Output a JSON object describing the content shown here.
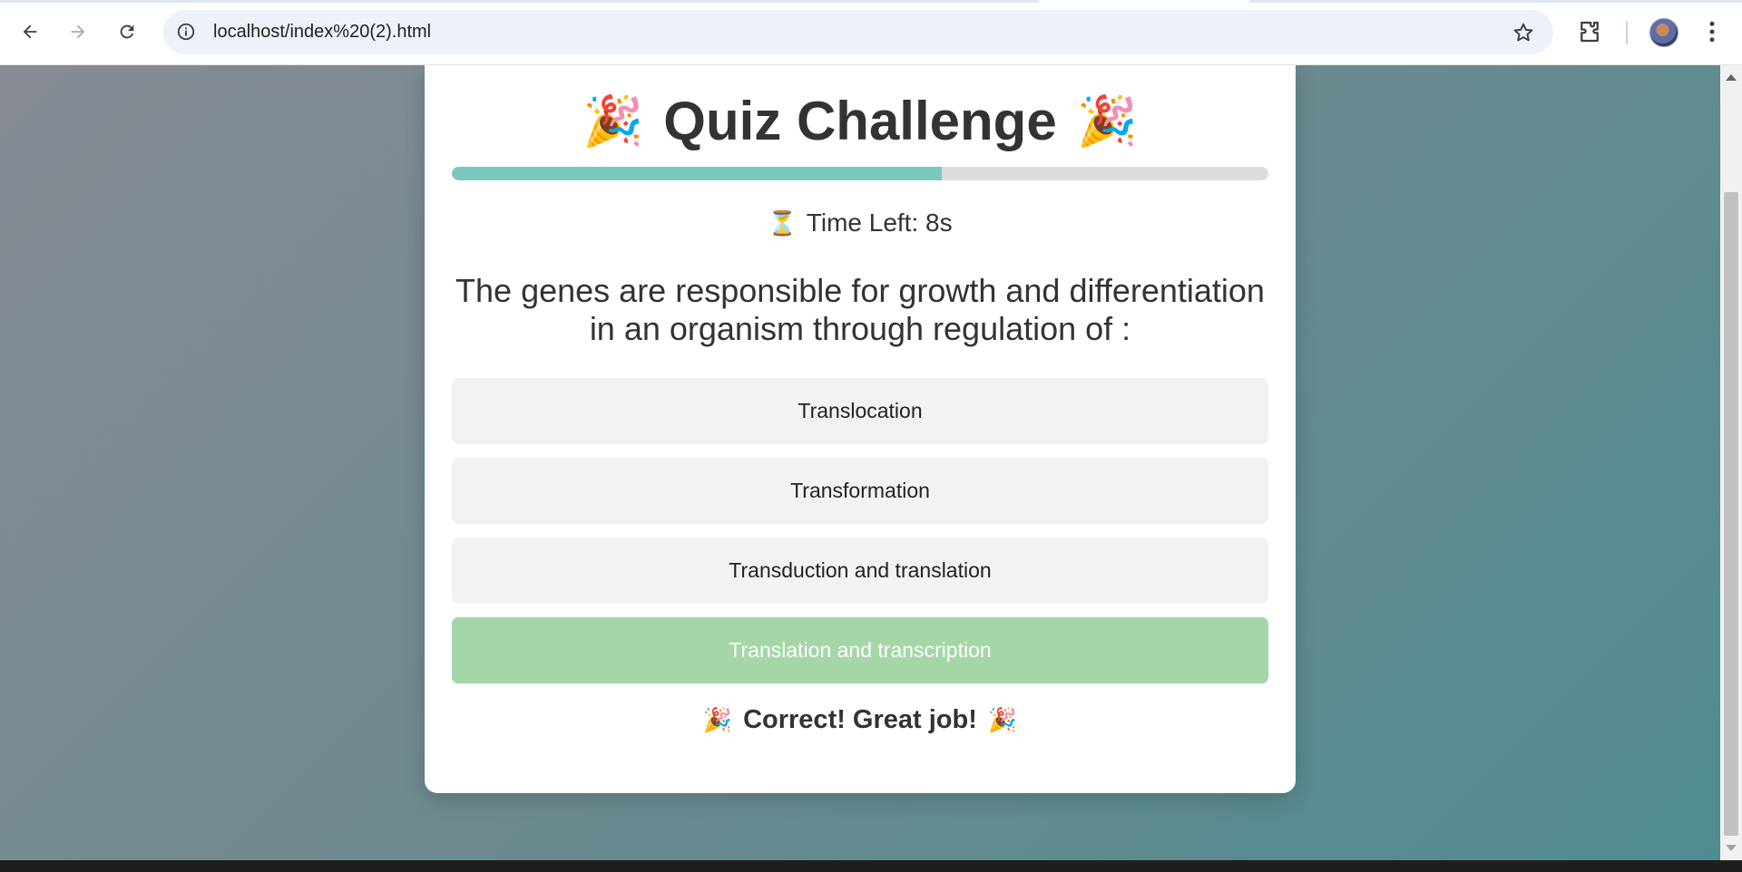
{
  "browser": {
    "url": "localhost/index%20(2).html",
    "icons": {
      "back": "back-arrow-icon",
      "forward": "forward-arrow-icon",
      "reload": "reload-icon",
      "site_info": "info-icon",
      "bookmark": "star-icon",
      "extensions": "puzzle-icon",
      "profile": "avatar",
      "menu": "kebab-menu-icon"
    }
  },
  "quiz": {
    "title": "Quiz Challenge",
    "title_emoji": "🎉",
    "progress_fraction": 0.6,
    "timer_icon": "⏳",
    "timer_text": "Time Left: 8s",
    "question": "The genes are responsible for growth and differentiation in an organism through regulation of :",
    "options": [
      {
        "label": "Translocation",
        "state": "default"
      },
      {
        "label": "Transformation",
        "state": "default"
      },
      {
        "label": "Transduction and translation",
        "state": "default"
      },
      {
        "label": "Translation and transcription",
        "state": "correct"
      }
    ],
    "feedback_emoji": "🎉",
    "feedback": "Correct! Great job!",
    "colors": {
      "progress": "#7cc8bf",
      "correct_option": "#a5d6a7",
      "option_bg": "#f2f2f2",
      "text": "#333333"
    }
  }
}
